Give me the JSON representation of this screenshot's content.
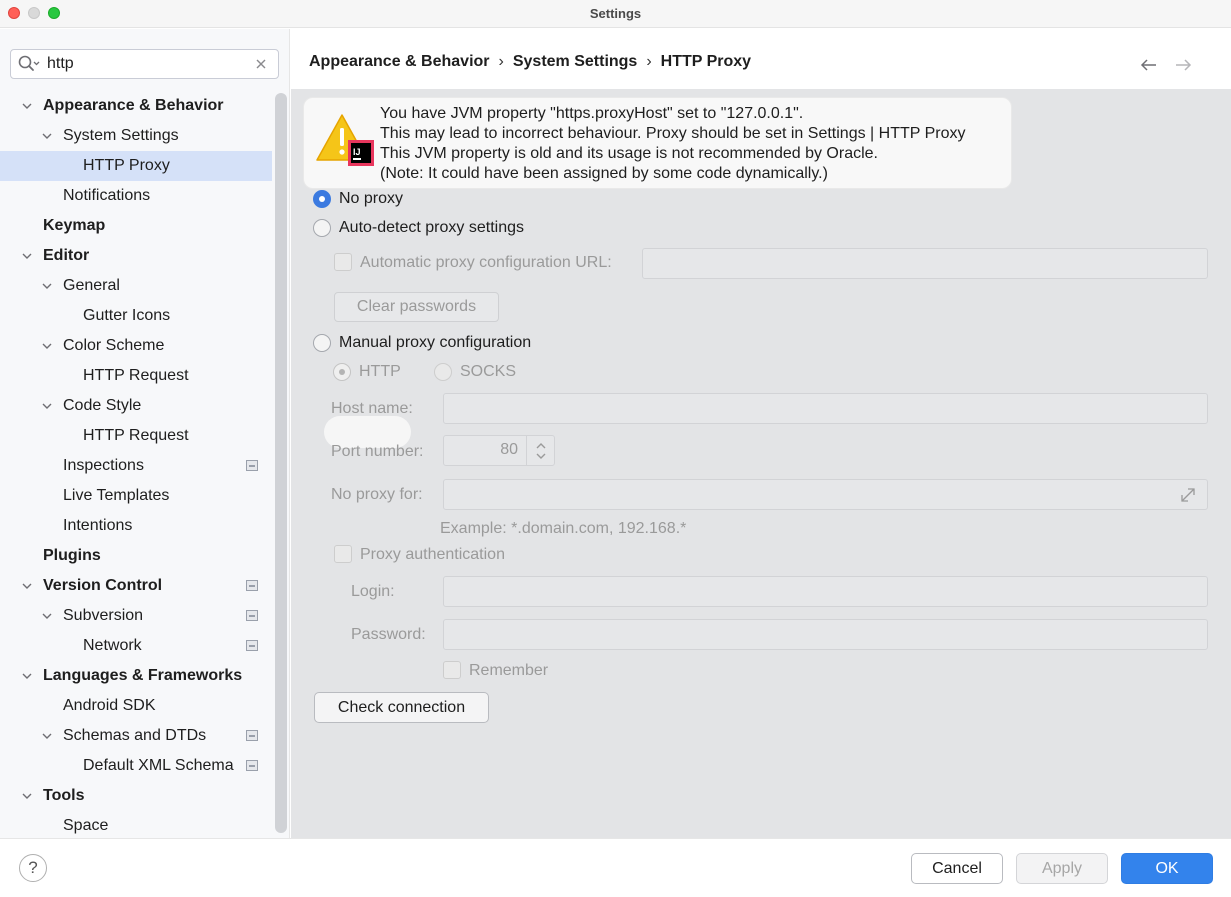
{
  "window": {
    "title": "Settings"
  },
  "search": {
    "value": "http",
    "placeholder": ""
  },
  "sidebar": {
    "items": [
      {
        "label": "Appearance & Behavior",
        "bold": true,
        "expanded": true,
        "level": 0
      },
      {
        "label": "System Settings",
        "bold": false,
        "expanded": true,
        "level": 1
      },
      {
        "label": "HTTP Proxy",
        "bold": false,
        "level": 2,
        "selected": true
      },
      {
        "label": "Notifications",
        "bold": false,
        "level": 1
      },
      {
        "label": "Keymap",
        "bold": true,
        "level": 0
      },
      {
        "label": "Editor",
        "bold": true,
        "expanded": true,
        "level": 0
      },
      {
        "label": "General",
        "bold": false,
        "expanded": true,
        "level": 1
      },
      {
        "label": "Gutter Icons",
        "bold": false,
        "level": 2
      },
      {
        "label": "Color Scheme",
        "bold": false,
        "expanded": true,
        "level": 1
      },
      {
        "label": "HTTP Request",
        "bold": false,
        "level": 2
      },
      {
        "label": "Code Style",
        "bold": false,
        "expanded": true,
        "level": 1
      },
      {
        "label": "HTTP Request",
        "bold": false,
        "level": 2
      },
      {
        "label": "Inspections",
        "bold": false,
        "level": 1,
        "badge": true
      },
      {
        "label": "Live Templates",
        "bold": false,
        "level": 1
      },
      {
        "label": "Intentions",
        "bold": false,
        "level": 1
      },
      {
        "label": "Plugins",
        "bold": true,
        "level": 0
      },
      {
        "label": "Version Control",
        "bold": true,
        "expanded": true,
        "level": 0,
        "badge": true
      },
      {
        "label": "Subversion",
        "bold": false,
        "expanded": true,
        "level": 1,
        "badge": true
      },
      {
        "label": "Network",
        "bold": false,
        "level": 2,
        "badge": true
      },
      {
        "label": "Languages & Frameworks",
        "bold": true,
        "expanded": true,
        "level": 0
      },
      {
        "label": "Android SDK",
        "bold": false,
        "level": 1
      },
      {
        "label": "Schemas and DTDs",
        "bold": false,
        "expanded": true,
        "level": 1,
        "badge": true
      },
      {
        "label": "Default XML Schema",
        "bold": false,
        "level": 2,
        "badge": true
      },
      {
        "label": "Tools",
        "bold": true,
        "expanded": true,
        "level": 0
      },
      {
        "label": "Space",
        "bold": false,
        "level": 1
      }
    ]
  },
  "breadcrumb": {
    "parts": [
      "Appearance & Behavior",
      "System Settings",
      "HTTP Proxy"
    ],
    "separator": "›"
  },
  "warning": {
    "lines": [
      "You have JVM property \"https.proxyHost\" set to \"127.0.0.1\".",
      "This may lead to incorrect behaviour. Proxy should be set in Settings | HTTP Proxy",
      "This JVM property is old and its usage is not recommended by Oracle.",
      "(Note: It could have been assigned by some code dynamically.)"
    ]
  },
  "proxy": {
    "no_proxy_label": "No proxy",
    "auto_detect_label": "Auto-detect proxy settings",
    "auto_config_url_label": "Automatic proxy configuration URL:",
    "auto_config_url_value": "",
    "clear_passwords_label": "Clear passwords",
    "manual_label": "Manual proxy configuration",
    "http_label": "HTTP",
    "socks_label": "SOCKS",
    "host_label": "Host name:",
    "host_value": "",
    "port_label": "Port number:",
    "port_value": "80",
    "no_proxy_for_label": "No proxy for:",
    "no_proxy_for_value": "",
    "example_text": "Example: *.domain.com, 192.168.*",
    "auth_label": "Proxy authentication",
    "login_label": "Login:",
    "login_value": "",
    "password_label": "Password:",
    "password_value": "",
    "remember_label": "Remember",
    "check_connection_label": "Check connection"
  },
  "footer": {
    "help_label": "?",
    "cancel_label": "Cancel",
    "apply_label": "Apply",
    "ok_label": "OK"
  },
  "colors": {
    "accent": "#3383ec",
    "selection": "#d5e1f8",
    "warning": "#f5c518"
  }
}
